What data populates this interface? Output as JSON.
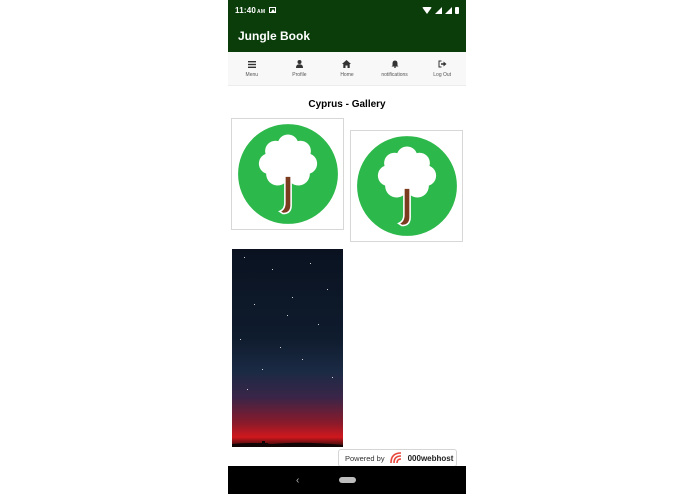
{
  "status_bar": {
    "time": "11:40",
    "time_suffix": "AM"
  },
  "app_bar": {
    "title": "Jungle Book"
  },
  "nav": {
    "items": [
      {
        "label": "Menu",
        "icon": "menu-icon"
      },
      {
        "label": "Profile",
        "icon": "user-icon"
      },
      {
        "label": "Home",
        "icon": "home-icon"
      },
      {
        "label": "notifications",
        "icon": "bell-icon"
      },
      {
        "label": "Log Out",
        "icon": "logout-icon"
      }
    ]
  },
  "gallery": {
    "title": "Cyprus - Gallery",
    "images": [
      {
        "name": "jungle-book-logo-1",
        "type": "tree-logo"
      },
      {
        "name": "jungle-book-logo-2",
        "type": "tree-logo"
      },
      {
        "name": "night-sky-photo",
        "type": "photo"
      }
    ]
  },
  "footer": {
    "powered_text": "Powered by",
    "brand": "000webhost"
  },
  "colors": {
    "app_bar": "#0b3d0b",
    "logo_green": "#2db84b",
    "trunk": "#7a3b1f"
  }
}
